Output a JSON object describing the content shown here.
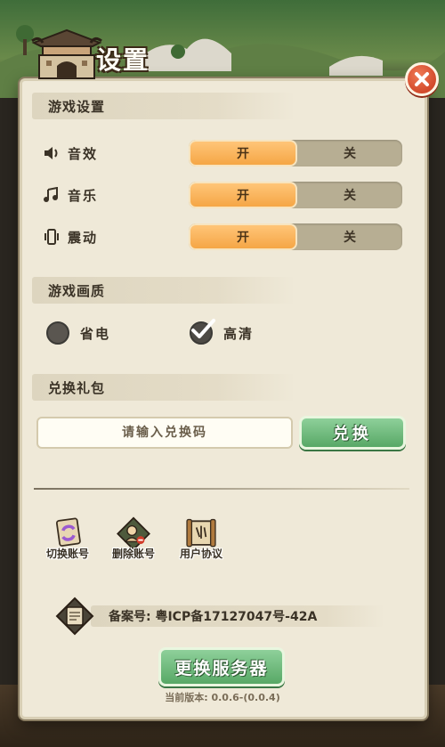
{
  "window": {
    "title": "设置"
  },
  "sections": {
    "game_settings": "游戏设置",
    "graphics": "游戏画质",
    "gift": "兑换礼包"
  },
  "audio": [
    {
      "label": "音效",
      "icon": "speaker-icon",
      "on": "开",
      "off": "关",
      "value": "on"
    },
    {
      "label": "音乐",
      "icon": "music-note-icon",
      "on": "开",
      "off": "关",
      "value": "on"
    },
    {
      "label": "震动",
      "icon": "vibrate-icon",
      "on": "开",
      "off": "关",
      "value": "on"
    }
  ],
  "graphics": {
    "options": [
      {
        "label": "省电",
        "selected": false
      },
      {
        "label": "高清",
        "selected": true
      }
    ]
  },
  "gift": {
    "placeholder": "请输入兑换码",
    "value": "",
    "button": "兑换"
  },
  "account": [
    {
      "label": "切换账号",
      "icon": "switch-account-icon"
    },
    {
      "label": "删除账号",
      "icon": "delete-account-icon"
    },
    {
      "label": "用户协议",
      "icon": "user-agreement-icon"
    }
  ],
  "icp": {
    "text": "备案号: 粤ICP备17127047号-42A",
    "icon": "scroll-icon"
  },
  "server_button": "更换服务器",
  "version": "当前版本: 0.0.6-(0.0.4)",
  "colors": {
    "panel": "#efe9d8",
    "toggle_on": "#f5a645",
    "toggle_off": "#b7ae93",
    "green_button": "#58a866",
    "close_button": "#d24a2c"
  }
}
